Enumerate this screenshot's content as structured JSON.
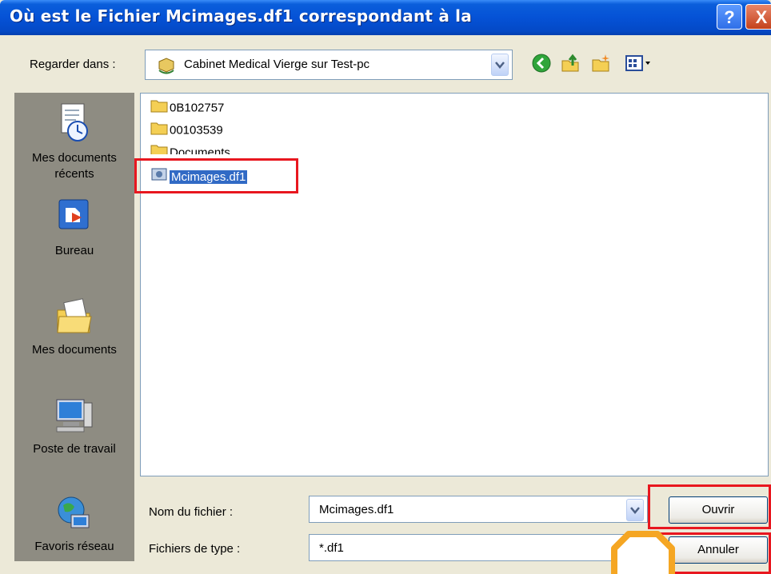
{
  "dialog": {
    "title": "Où est le Fichier Mcimages.df1 correspondant à la",
    "help_label": "?",
    "close_label": "X"
  },
  "lookin": {
    "label": "Regarder dans :",
    "value": "Cabinet Medical Vierge sur Test-pc"
  },
  "places": [
    {
      "label": "Mes documents récents",
      "icon": "recent-documents-icon"
    },
    {
      "label": "Bureau",
      "icon": "desktop-icon"
    },
    {
      "label": "Mes documents",
      "icon": "my-documents-icon"
    },
    {
      "label": "Poste de travail",
      "icon": "my-computer-icon"
    },
    {
      "label": "Favoris réseau",
      "icon": "network-places-icon"
    }
  ],
  "files": [
    {
      "name": "0B102757",
      "icon": "folder-icon"
    },
    {
      "name": "00103539",
      "icon": "folder-icon"
    },
    {
      "name": "Documents",
      "icon": "folder-icon"
    },
    {
      "name": "Mcimages.df1",
      "icon": "file-icon",
      "selected": true
    }
  ],
  "filename": {
    "label": "Nom du fichier :",
    "value": "Mcimages.df1"
  },
  "filetype": {
    "label": "Fichiers de type :",
    "value": "*.df1"
  },
  "buttons": {
    "open": "Ouvrir",
    "cancel": "Annuler"
  },
  "colors": {
    "titlebar": "#0552D6",
    "selection": "#316AC5",
    "highlight_box": "#E8171F",
    "places_bar": "#8E8C82",
    "dialog_bg": "#ECE9D8",
    "orange_annotation": "#F5A623"
  }
}
